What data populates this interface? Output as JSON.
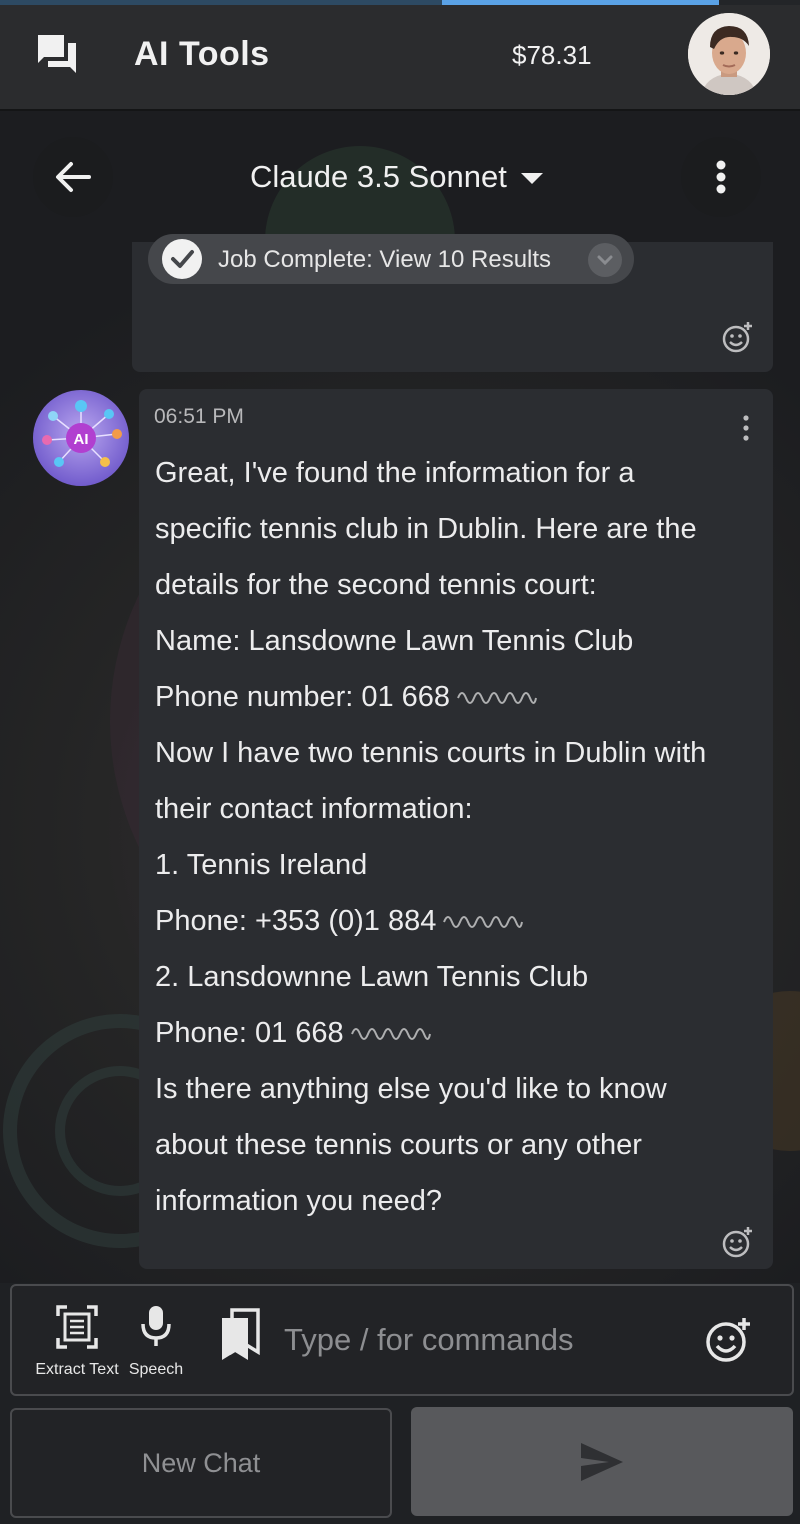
{
  "header": {
    "app_title": "AI Tools",
    "balance": "$78.31"
  },
  "chat_header": {
    "model_name": "Claude 3.5 Sonnet"
  },
  "previous_message": {
    "job_status": "Job Complete: View 10 Results"
  },
  "message": {
    "time": "06:51 PM",
    "lines": [
      "Great, I've found the information for a",
      "specific tennis club in Dublin. Here are the",
      "details for the second tennis court:",
      "Name: Lansdowne Lawn Tennis Club",
      "Phone number: 01 668",
      "Now I have two tennis courts in Dublin with",
      "their contact information:",
      "1. Tennis Ireland",
      "Phone: +353 (0)1 884",
      "2. Lansdownne Lawn Tennis Club",
      "Phone: 01 668",
      "Is there anything else you'd like to know",
      "about these tennis courts or any other",
      "information you need?"
    ]
  },
  "composer": {
    "extract_text_label": "Extract Text",
    "speech_label": "Speech",
    "placeholder": "Type / for commands"
  },
  "footer": {
    "new_chat_label": "New Chat"
  },
  "colors": {
    "background": "#1f2124",
    "bubble": "#2b2d31",
    "progress_accent": "#5aa2e6"
  },
  "icons": {
    "top_left": "chat-bubbles-icon",
    "back": "arrow-left-icon",
    "more": "vertical-dots-icon",
    "send": "send-icon",
    "reaction": "emoji-add-icon"
  }
}
